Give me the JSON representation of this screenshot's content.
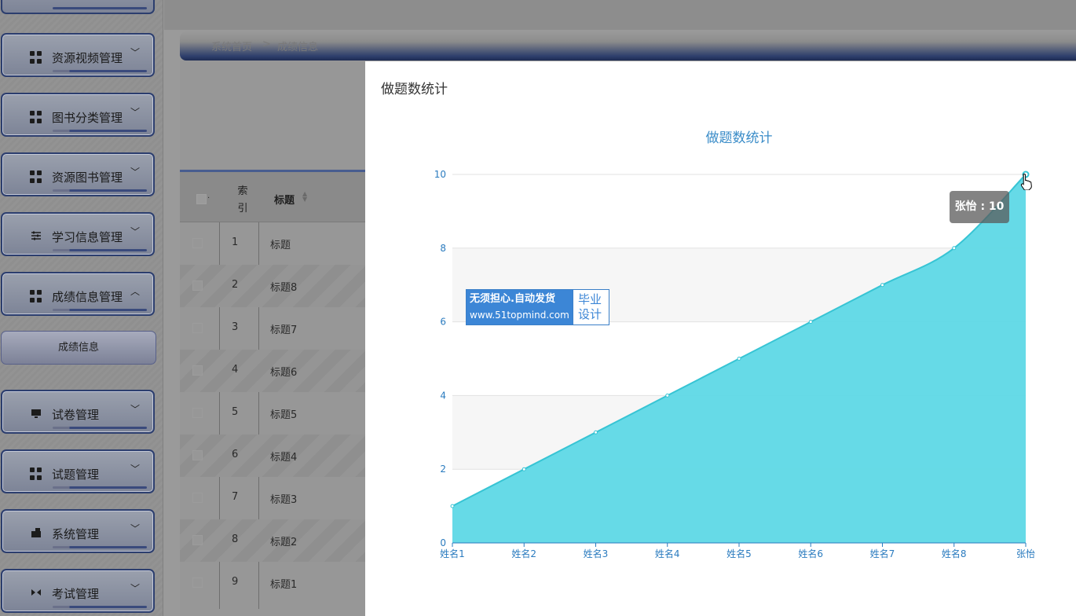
{
  "sidebar": {
    "items": [
      {
        "label": "资源视频管理",
        "icon": "grid-icon",
        "expanded": false
      },
      {
        "label": "图书分类管理",
        "icon": "grid-icon",
        "expanded": false
      },
      {
        "label": "资源图书管理",
        "icon": "grid-icon",
        "expanded": false
      },
      {
        "label": "学习信息管理",
        "icon": "sliders-icon",
        "expanded": false
      },
      {
        "label": "成绩信息管理",
        "icon": "grid-icon",
        "expanded": true
      },
      {
        "label": "试卷管理",
        "icon": "monitor-icon",
        "expanded": false
      },
      {
        "label": "试题管理",
        "icon": "grid-icon",
        "expanded": false
      },
      {
        "label": "系统管理",
        "icon": "camera-icon",
        "expanded": false
      },
      {
        "label": "考试管理",
        "icon": "exam-icon",
        "expanded": false
      }
    ],
    "submenu_active": "成绩信息"
  },
  "breadcrumb": {
    "home": "系统首页",
    "separator": ">",
    "current": "成绩信息"
  },
  "table": {
    "headers": {
      "index": "索引",
      "title": "标题"
    },
    "rows": [
      {
        "index": "1",
        "title": "标题"
      },
      {
        "index": "2",
        "title": "标题8"
      },
      {
        "index": "3",
        "title": "标题7"
      },
      {
        "index": "4",
        "title": "标题6"
      },
      {
        "index": "5",
        "title": "标题5"
      },
      {
        "index": "6",
        "title": "标题4"
      },
      {
        "index": "7",
        "title": "标题3"
      },
      {
        "index": "8",
        "title": "标题2"
      },
      {
        "index": "9",
        "title": "标题1"
      }
    ]
  },
  "modal": {
    "title": "做题数统计"
  },
  "tooltip": {
    "text": "张怡 : 10"
  },
  "watermark": {
    "line1": "无须担心.自动发货",
    "line2": "www.51topmind.com",
    "right1": "毕业",
    "right2": "设计"
  },
  "colors": {
    "area_fill": "#5ed8e6",
    "line": "#37c4d4",
    "axis_text": "#2a7bbf",
    "chart_title": "#3a8cc8",
    "sidebar_border": "#2c3e6e"
  },
  "chart_data": {
    "type": "area",
    "title": "做题数统计",
    "categories": [
      "姓名1",
      "姓名2",
      "姓名3",
      "姓名4",
      "姓名5",
      "姓名6",
      "姓名7",
      "姓名8",
      "张怡"
    ],
    "values": [
      1,
      2,
      3,
      4,
      5,
      6,
      7,
      8,
      10
    ],
    "ylim": [
      0,
      10
    ],
    "yticks": [
      0,
      2,
      4,
      6,
      8,
      10
    ],
    "smooth": true,
    "grid": "horizontal-banded",
    "highlight_index": 8
  }
}
